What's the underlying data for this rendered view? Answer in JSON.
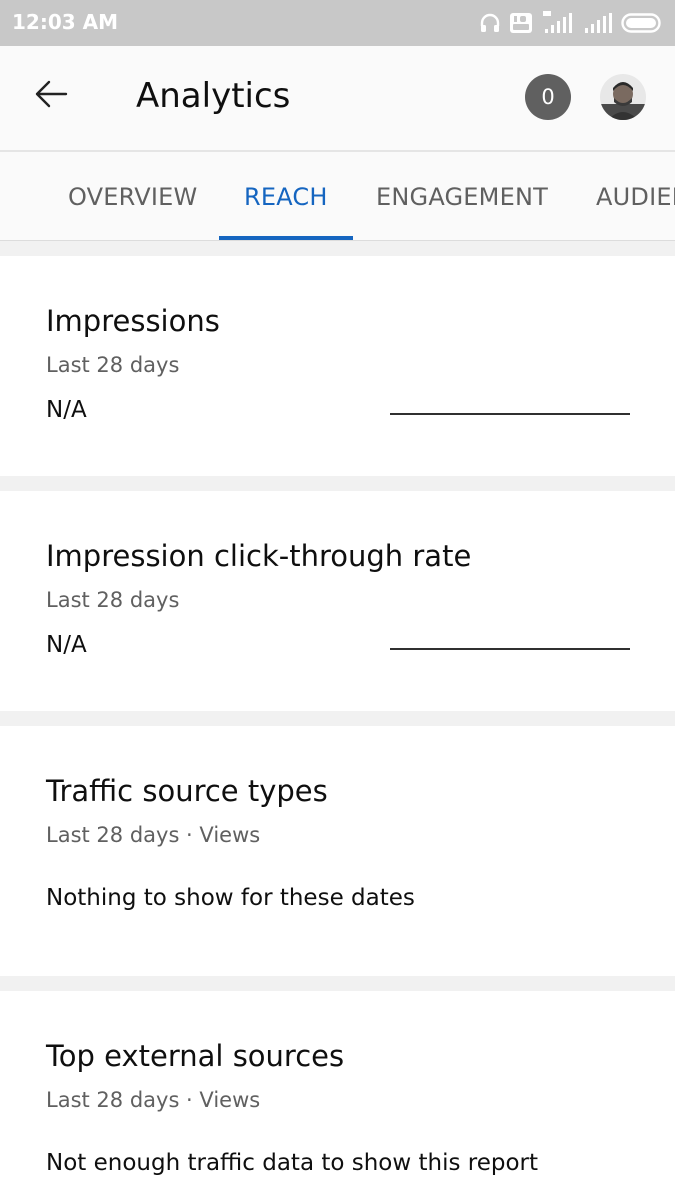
{
  "status_bar": {
    "time": "12:03 AM",
    "icons": [
      "headset-icon",
      "volte-icon",
      "signal-4g-icon",
      "signal-icon",
      "battery-icon"
    ]
  },
  "header": {
    "title": "Analytics",
    "notification_count": "0",
    "back_icon": "arrow-left-icon"
  },
  "tabs": [
    {
      "label": "OVERVIEW",
      "active": false
    },
    {
      "label": "REACH",
      "active": true
    },
    {
      "label": "ENGAGEMENT",
      "active": false
    },
    {
      "label": "AUDIENCE",
      "active": false
    }
  ],
  "cards": {
    "impressions": {
      "title": "Impressions",
      "subtitle": "Last 28 days",
      "value": "N/A"
    },
    "ctr": {
      "title": "Impression click-through rate",
      "subtitle": "Last 28 days",
      "value": "N/A"
    },
    "traffic_sources": {
      "title": "Traffic source types",
      "subtitle": "Last 28 days · Views",
      "message": "Nothing to show for these dates"
    },
    "external_sources": {
      "title": "Top external sources",
      "subtitle": "Last 28 days · Views",
      "message": "Not enough traffic data to show this report"
    }
  },
  "colors": {
    "accent": "#1565c0",
    "status_bar": "#c8c8c8",
    "badge": "#606060"
  }
}
